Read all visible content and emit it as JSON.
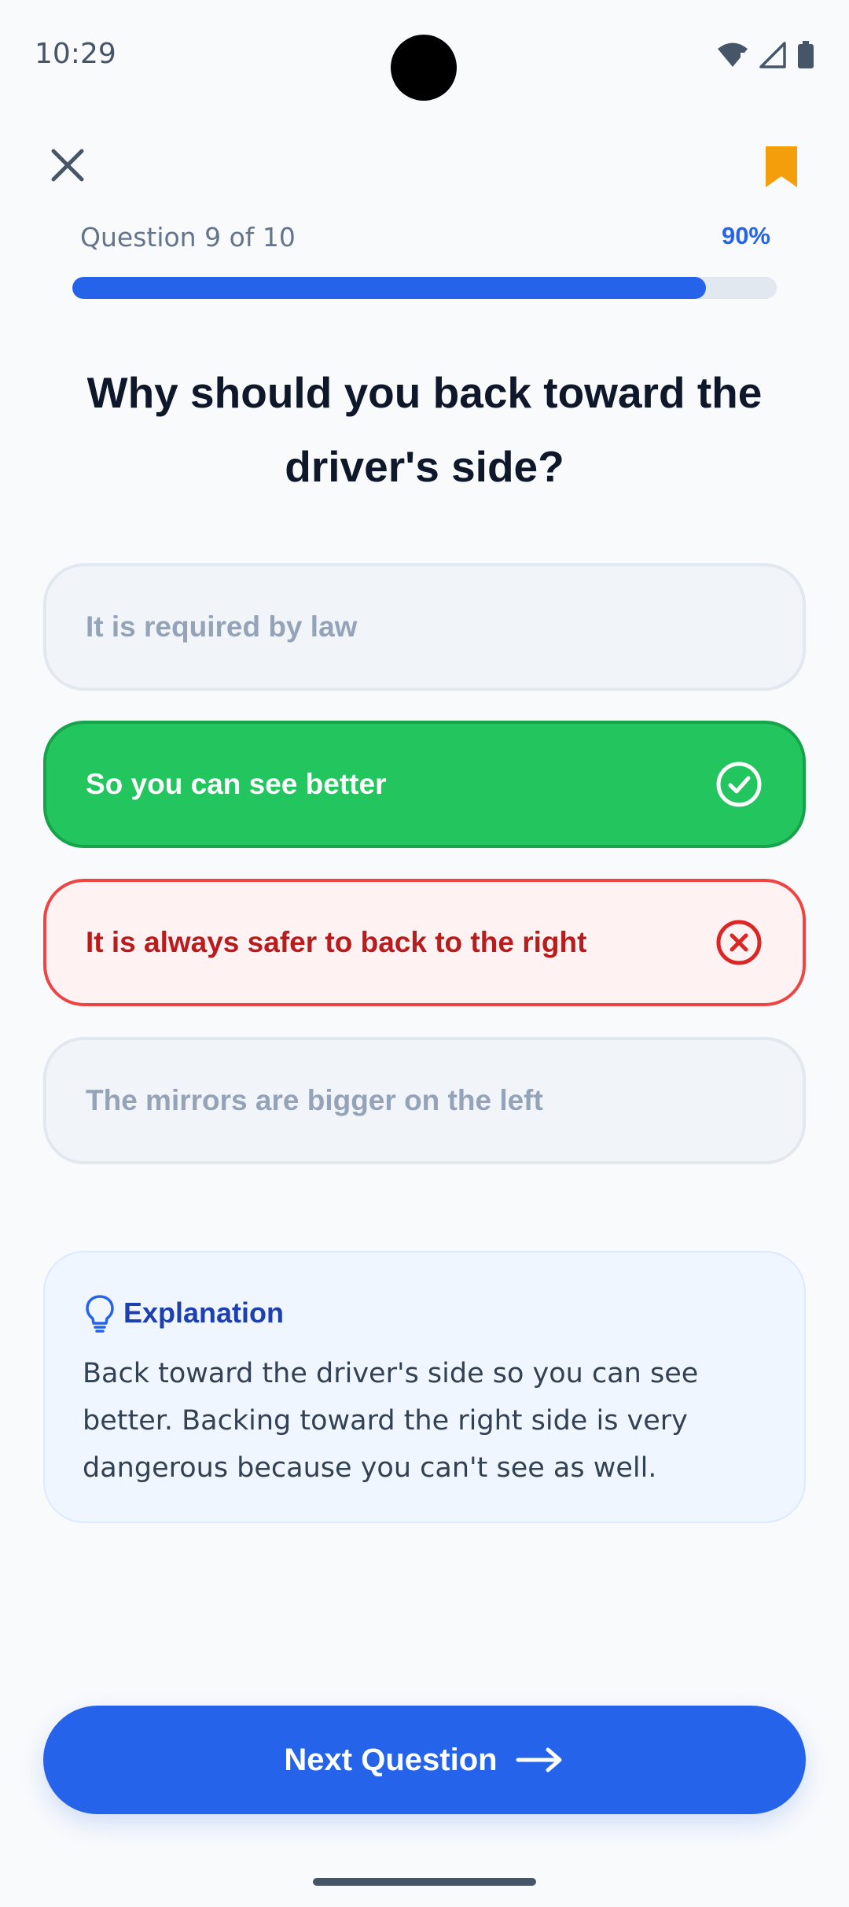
{
  "status_bar": {
    "time": "10:29",
    "icons": [
      "wifi-icon",
      "signal-icon",
      "battery-icon"
    ]
  },
  "top_bar": {
    "close_icon": "close-icon",
    "bookmark_icon": "bookmark-icon"
  },
  "progress": {
    "label": "Question 9 of 10",
    "percent_label": "90%",
    "value": 0.9
  },
  "question": {
    "text": "Why should you back toward the driver's side?"
  },
  "options": [
    {
      "label": "It is required by law",
      "state": "neutral"
    },
    {
      "label": "So you can see better",
      "state": "correct",
      "icon": "check-circle-icon"
    },
    {
      "label": "It is always safer to back to the right",
      "state": "wrong",
      "icon": "x-circle-icon"
    },
    {
      "label": "The mirrors are bigger on the left",
      "state": "neutral"
    }
  ],
  "explanation": {
    "icon": "lightbulb-icon",
    "title": "Explanation",
    "text": "Back toward the driver's side so you can see better. Backing toward the right side is very dangerous because you can't see as well."
  },
  "next_button": {
    "label": "Next Question",
    "icon": "arrow-right-icon"
  },
  "colors": {
    "accent": "#2563eb",
    "correct": "#22c55e",
    "wrong": "#ef4444",
    "bookmark": "#f59e0b"
  }
}
